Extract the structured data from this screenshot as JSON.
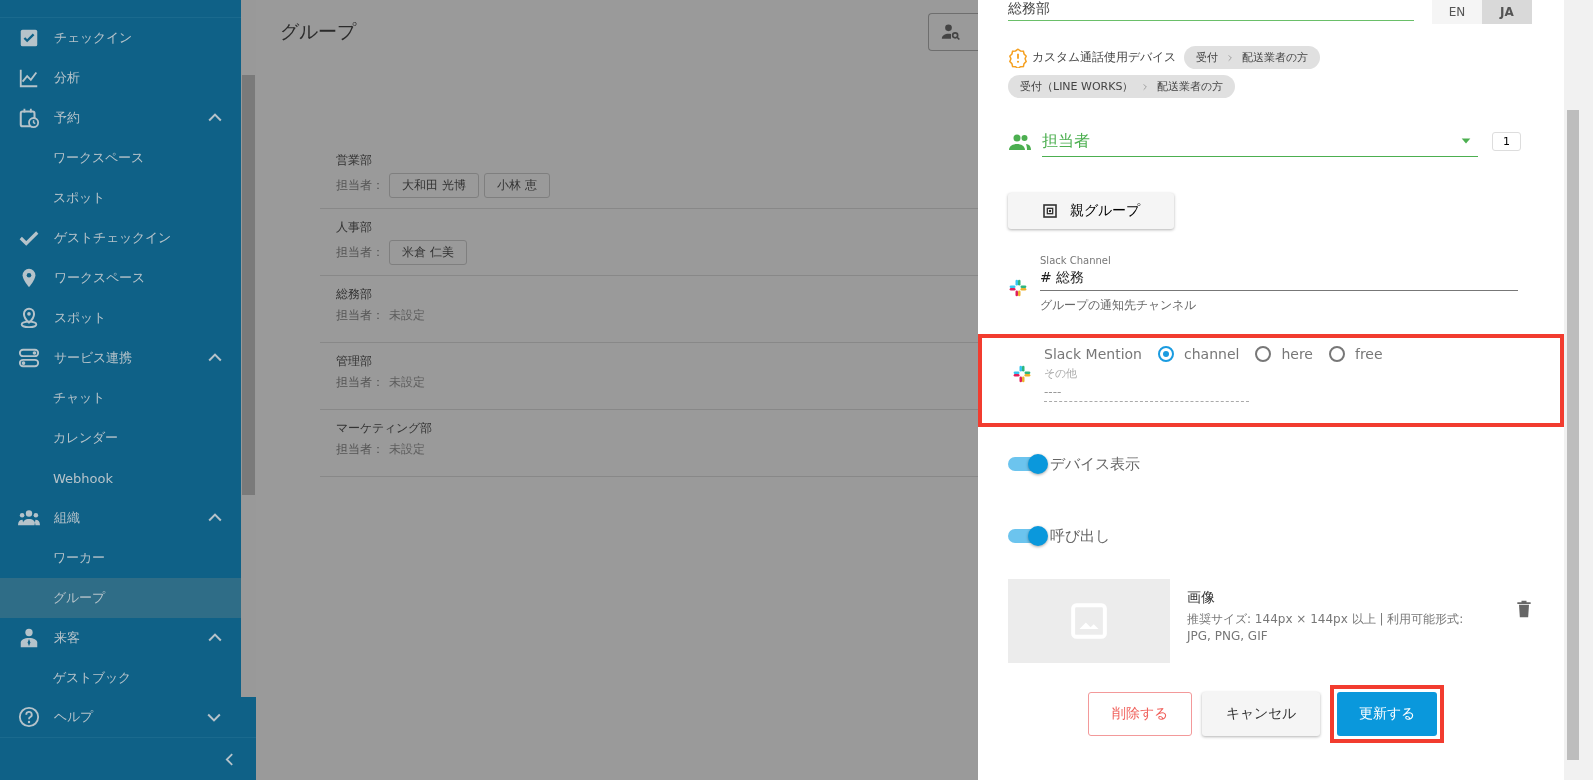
{
  "sidebar": {
    "items": [
      {
        "label": "チェックイン",
        "selected": false
      },
      {
        "label": "分析",
        "selected": false
      },
      {
        "label": "予約",
        "selected": false,
        "expanded": true,
        "children": [
          {
            "label": "ワークスペース",
            "selected": false
          },
          {
            "label": "スポット",
            "selected": false
          }
        ]
      },
      {
        "label": "ゲストチェックイン",
        "selected": false
      },
      {
        "label": "ワークスペース",
        "selected": false
      },
      {
        "label": "スポット",
        "selected": false
      },
      {
        "label": "サービス連携",
        "selected": false,
        "expanded": true,
        "children": [
          {
            "label": "チャット",
            "selected": false
          },
          {
            "label": "カレンダー",
            "selected": false
          },
          {
            "label": "Webhook",
            "selected": false
          }
        ]
      },
      {
        "label": "組織",
        "selected": false,
        "expanded": true,
        "children": [
          {
            "label": "ワーカー",
            "selected": false
          },
          {
            "label": "グループ",
            "selected": true
          }
        ]
      },
      {
        "label": "来客",
        "selected": false,
        "expanded": true,
        "children": [
          {
            "label": "ゲストブック",
            "selected": false
          }
        ]
      }
    ],
    "help": {
      "label": "ヘルプ",
      "expanded": false
    }
  },
  "page": {
    "title": "グループ"
  },
  "groups": [
    {
      "name": "営業部",
      "assignee_label": "担当者：",
      "assignees": [
        "大和田 光博",
        "小林 恵"
      ]
    },
    {
      "name": "人事部",
      "assignee_label": "担当者：",
      "assignees": [
        "米倉 仁美"
      ]
    },
    {
      "name": "総務部",
      "assignee_label": "担当者：",
      "unassigned": "未設定"
    },
    {
      "name": "管理部",
      "assignee_label": "担当者：",
      "unassigned": "未設定"
    },
    {
      "name": "マーケティング部",
      "assignee_label": "担当者：",
      "unassigned": "未設定"
    }
  ],
  "drawer": {
    "name_field": {
      "value": "総務部"
    },
    "languages": [
      {
        "label": "EN",
        "selected": false
      },
      {
        "label": "JA",
        "selected": true
      }
    ],
    "devices": {
      "label": "カスタム通話使用デバイス",
      "chips": [
        {
          "from": "受付",
          "to": "配送業者の方"
        },
        {
          "from": "受付（LINE WORKS）",
          "to": "配送業者の方"
        }
      ]
    },
    "assignee_select": {
      "label": "担当者",
      "count": "1"
    },
    "parent_group_button": "親グループ",
    "slack_channel": {
      "label": "Slack Channel",
      "value": "# 総務",
      "hint": "グループの通知先チャンネル"
    },
    "slack_mention": {
      "label": "Slack Mention",
      "highlighted": true,
      "options": [
        {
          "label": "channel",
          "selected": true
        },
        {
          "label": "here",
          "selected": false
        },
        {
          "label": "free",
          "selected": false
        }
      ],
      "other_label": "その他",
      "other_value": "----"
    },
    "toggles": [
      {
        "label": "デバイス表示",
        "on": true
      },
      {
        "label": "呼び出し",
        "on": true
      }
    ],
    "image": {
      "title": "画像",
      "description": "推奨サイズ: 144px × 144px 以上 | 利用可能形式: JPG, PNG, GIF"
    },
    "buttons": [
      {
        "kind": "delete",
        "label": "削除する",
        "highlighted": false
      },
      {
        "kind": "cancel",
        "label": "キャンセル",
        "highlighted": false
      },
      {
        "kind": "update",
        "label": "更新する",
        "highlighted": true
      }
    ]
  }
}
